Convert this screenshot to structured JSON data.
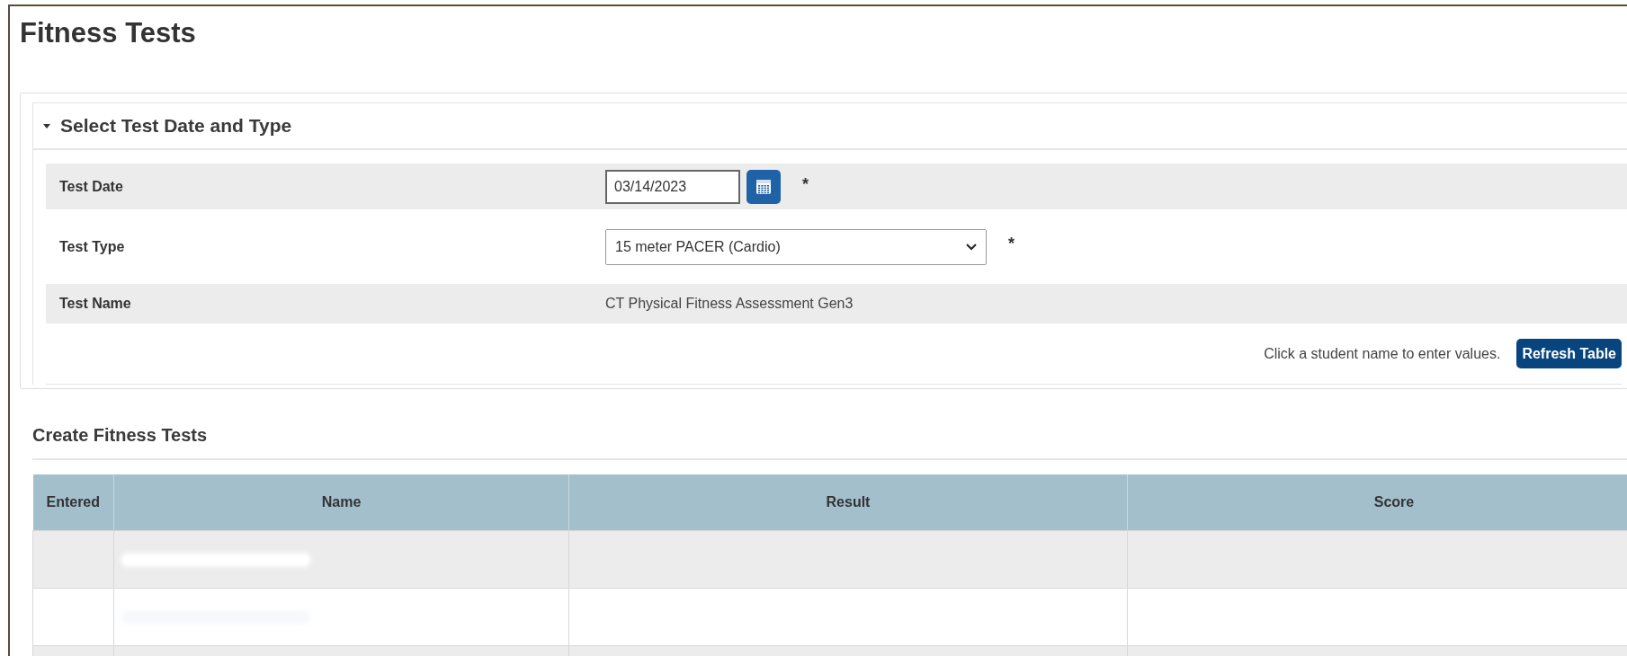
{
  "page": {
    "title": "Fitness Tests"
  },
  "panel": {
    "title": "Select Test Date and Type",
    "expanded": true,
    "fields": [
      {
        "kind": "date",
        "label": "Test Date",
        "value": "03/14/2023",
        "marker": "*"
      },
      {
        "kind": "select",
        "label": "Test Type",
        "value": "15 meter PACER (Cardio)",
        "marker": "*"
      },
      {
        "kind": "text",
        "label": "Test Name",
        "value": "CT Physical Fitness Assessment Gen3"
      }
    ],
    "hint": "Click a student name to enter values.",
    "refresh_button": "Refresh Table"
  },
  "section": {
    "title": "Create Fitness Tests"
  },
  "table": {
    "columns": [
      "Entered",
      "Name",
      "Result",
      "Score"
    ],
    "rows": [
      {
        "kind": "redacted"
      },
      {
        "kind": "redacted"
      },
      {
        "kind": "blank"
      }
    ]
  }
}
